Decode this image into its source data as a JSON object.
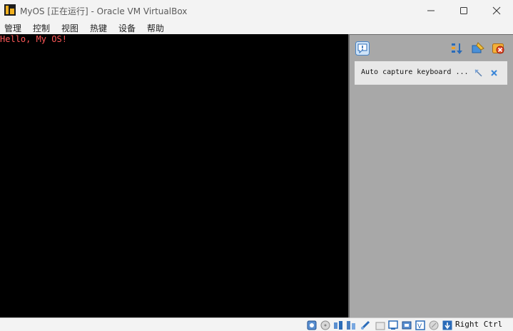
{
  "window": {
    "title": "MyOS [正在运行] - Oracle VM VirtualBox",
    "icon": "virtualbox-app-icon"
  },
  "menu": {
    "items": [
      {
        "label": "管理"
      },
      {
        "label": "控制"
      },
      {
        "label": "视图"
      },
      {
        "label": "热键"
      },
      {
        "label": "设备"
      },
      {
        "label": "帮助"
      }
    ]
  },
  "vm_screen": {
    "console_text": "Hello, My OS!",
    "text_color": "#ff5858",
    "background": "#000000"
  },
  "notification_panel": {
    "messages": [
      {
        "text": "Auto capture keyboard ..."
      }
    ],
    "icons": [
      "message-center-icon",
      "sort-icon",
      "toggle-ignore-icon",
      "close-all-icon"
    ]
  },
  "statusbar": {
    "icons": [
      "hard-disk-icon",
      "optical-drive-icon",
      "audio-icon",
      "network-icon",
      "usb-icon",
      "shared-folders-icon",
      "display-icon",
      "video-capture-icon",
      "cpu-icon",
      "mouse-integration-icon",
      "keyboard-icon"
    ],
    "host_key": "Right Ctrl"
  }
}
